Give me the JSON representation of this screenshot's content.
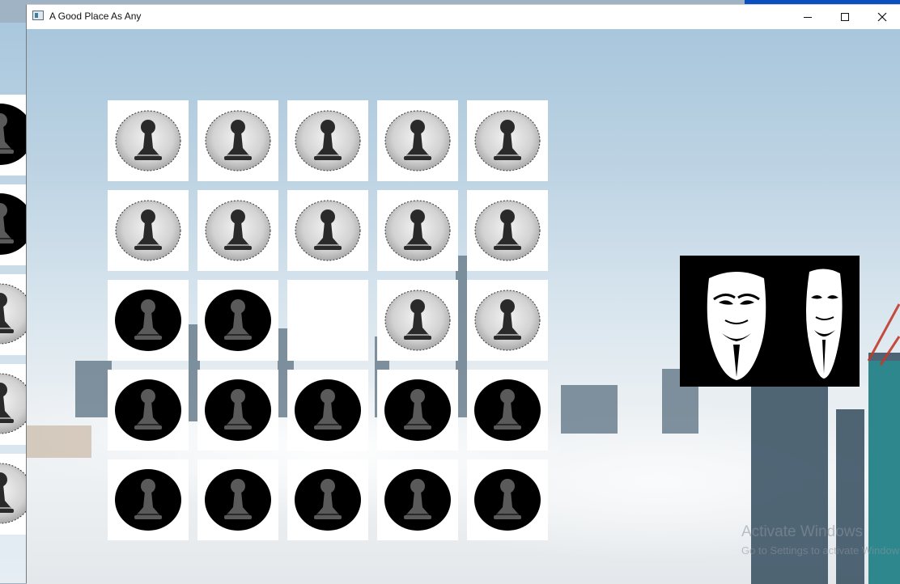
{
  "window": {
    "title": "A Good Place As Any",
    "controls": [
      "minimize",
      "maximize",
      "close"
    ]
  },
  "board": {
    "rows": 5,
    "cols": 5,
    "cells": [
      [
        "white",
        "white",
        "white",
        "white",
        "white"
      ],
      [
        "white",
        "white",
        "white",
        "white",
        "white"
      ],
      [
        "black",
        "black",
        "empty",
        "white",
        "white"
      ],
      [
        "black",
        "black",
        "black",
        "black",
        "black"
      ],
      [
        "black",
        "black",
        "black",
        "black",
        "black"
      ]
    ]
  },
  "pieces": {
    "white_icon": "pawn-light-disc-icon",
    "black_icon": "pawn-dark-disc-icon"
  },
  "side_image": {
    "icon": "guy-fawkes-masks-icon"
  },
  "watermark": {
    "title": "Activate Windows",
    "subtitle": "Go to Settings to activate Windows."
  },
  "colors": {
    "white_disc": "#d6d6d6",
    "black_disc": "#000000",
    "pawn_on_white": "#2a2a2a",
    "pawn_on_black": "#555555"
  }
}
